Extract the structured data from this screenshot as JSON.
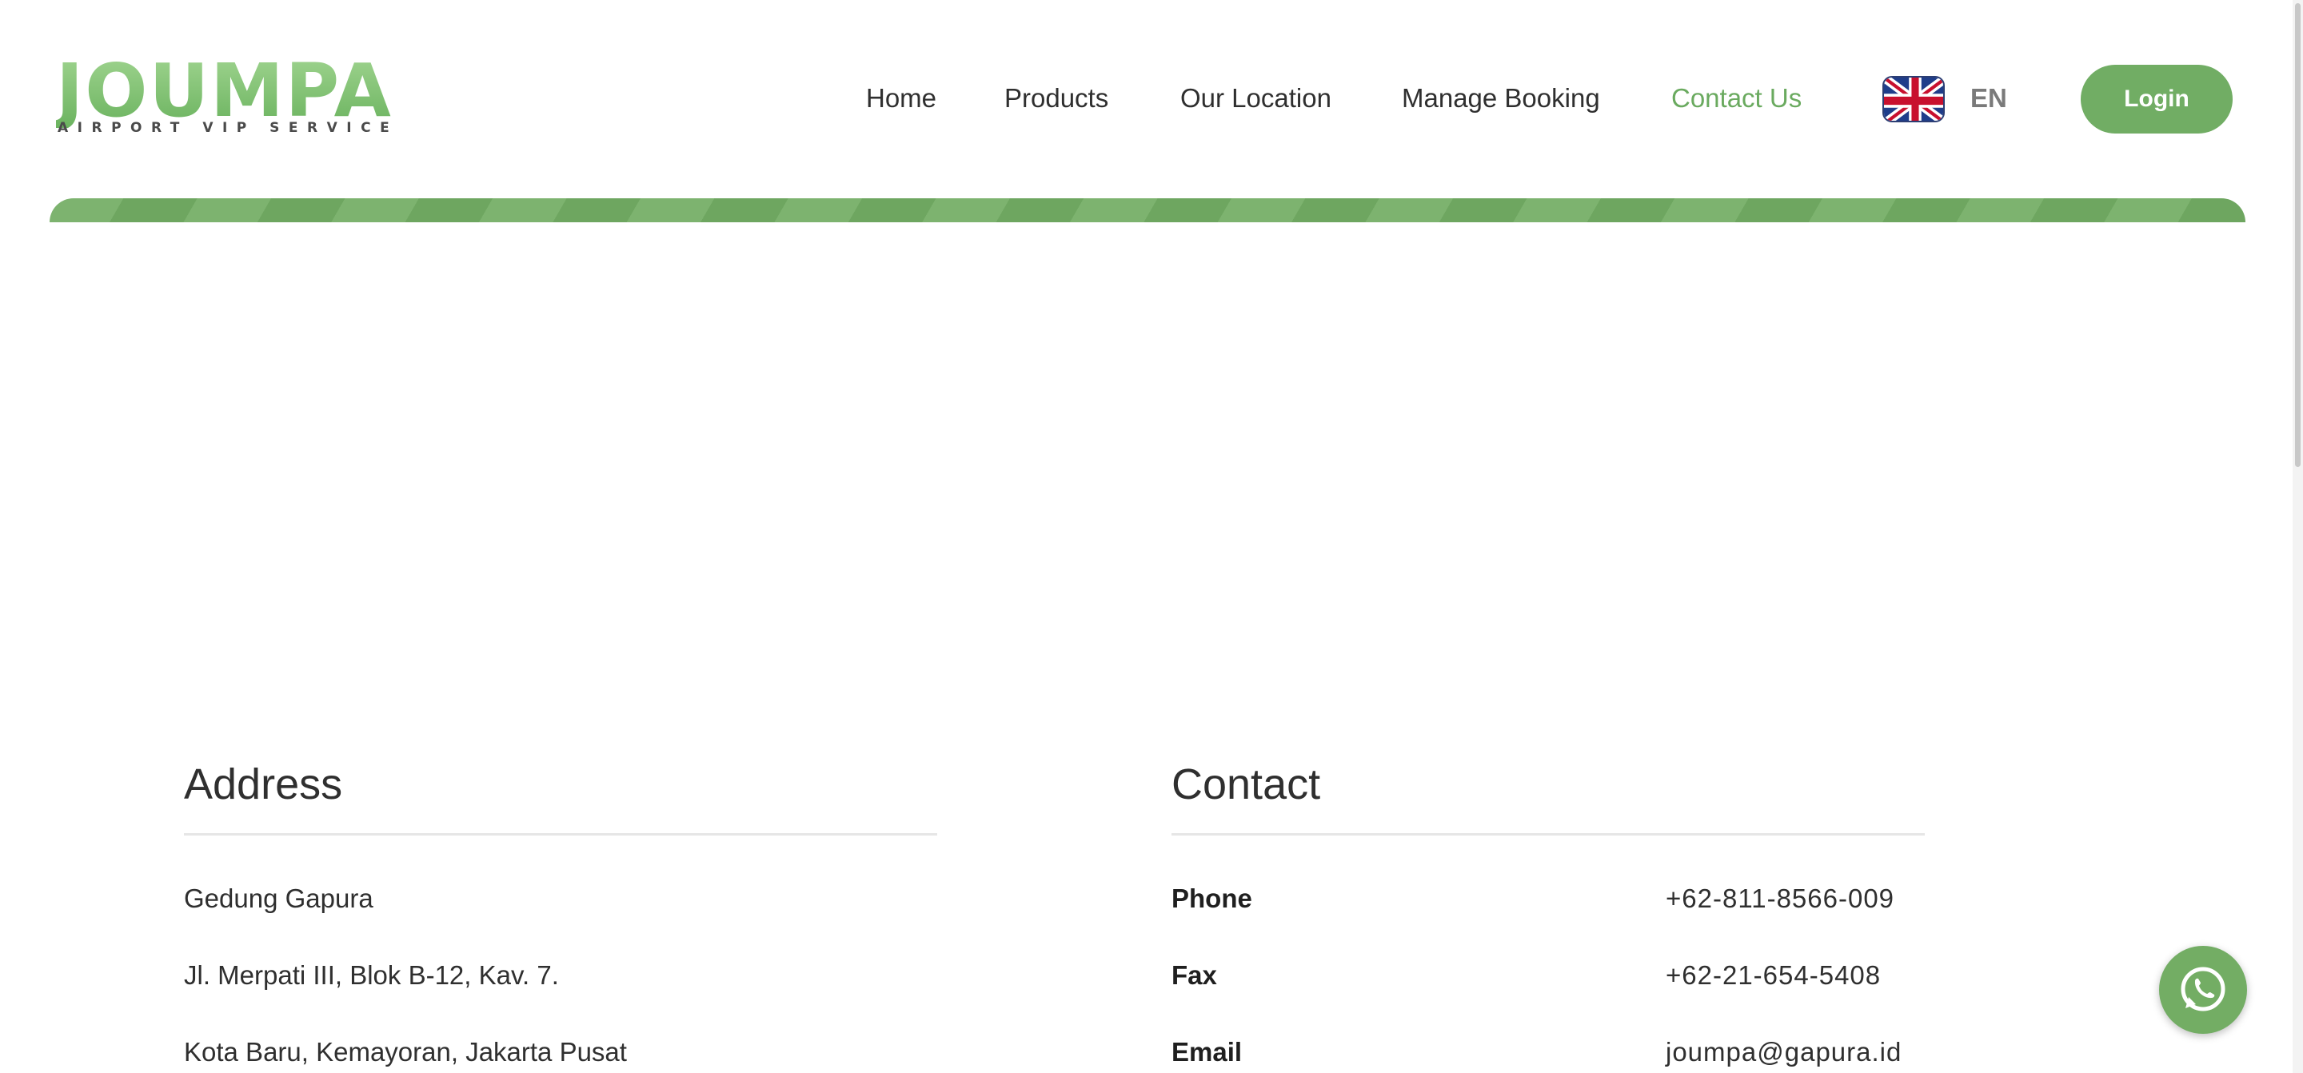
{
  "brand": {
    "name": "JOUMPA",
    "tagline": "AIRPORT VIP SERVICE",
    "accent_color": "#71ad64"
  },
  "nav": {
    "items": [
      {
        "label": "Home",
        "active": false
      },
      {
        "label": "Products",
        "active": false
      },
      {
        "label": "Our Location",
        "active": false
      },
      {
        "label": "Manage Booking",
        "active": false
      },
      {
        "label": "Contact Us",
        "active": true
      }
    ],
    "language": "EN",
    "language_icon": "uk-flag-icon",
    "login_label": "Login"
  },
  "address": {
    "title": "Address",
    "lines": [
      "Gedung Gapura",
      "Jl. Merpati III, Blok B-12, Kav. 7.",
      "Kota Baru, Kemayoran, Jakarta Pusat"
    ]
  },
  "contact": {
    "title": "Contact",
    "rows": [
      {
        "label": "Phone",
        "value": "+62-811-8566-009"
      },
      {
        "label": "Fax",
        "value": "+62-21-654-5408"
      },
      {
        "label": "Email",
        "value": "joumpa@gapura.id"
      }
    ]
  },
  "floating": {
    "icon": "whatsapp-icon"
  }
}
